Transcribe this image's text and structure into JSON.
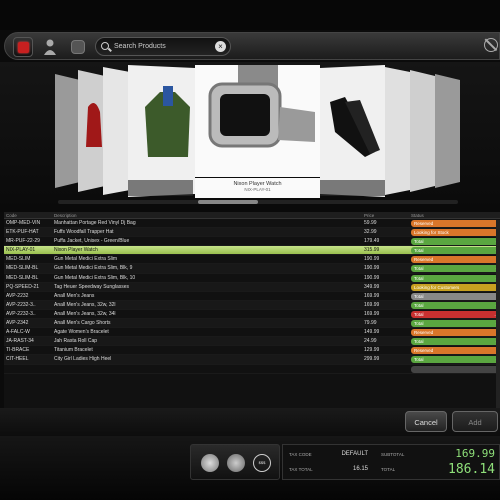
{
  "toolbar": {
    "search_placeholder": "Search Products",
    "clear_label": "×"
  },
  "coverflow": {
    "selected_title": "Nixon Player Watch",
    "selected_code": "NIX-PLAY-01"
  },
  "grid": {
    "columns": [
      "Code",
      "Description",
      "Price",
      "Status"
    ],
    "rows": [
      {
        "code": "OMP-MED-VIN",
        "desc": "Manhattan Portage Red Vinyl Dj Bag",
        "price": "59.99",
        "status": "Reserved",
        "color": "#d9762a",
        "num": ""
      },
      {
        "code": "ETK-PUF-HAT",
        "desc": "Fuffs Woodfall Trapper Hat",
        "price": "32.99",
        "status": "Looking for Stock",
        "color": "#d9762a",
        "num": ""
      },
      {
        "code": "MR-PUF-22-29",
        "desc": "Puffa Jacket, Unisex - Green/Blue",
        "price": "179.49",
        "status": "Total",
        "color": "#5aa640",
        "num": "0"
      },
      {
        "code": "NIX-PLAY-01",
        "desc": "Nixon Player Watch",
        "price": "315.99",
        "status": "Total",
        "color": "#5aa640",
        "num": "0"
      },
      {
        "code": "MED-SLIM",
        "desc": "Gun Metal Medici Extra Slim",
        "price": "190.99",
        "status": "Reserved",
        "color": "#d9762a",
        "num": ""
      },
      {
        "code": "MED-SLIM-BL",
        "desc": "Gun Metal Medici Extra Slim, Blk, 9",
        "price": "190.99",
        "status": "Total",
        "color": "#5aa640",
        "num": "0"
      },
      {
        "code": "MED-SLIM-BL",
        "desc": "Gun Metal Medici Extra Slim, Blk, 10",
        "price": "190.99",
        "status": "Total",
        "color": "#5aa640",
        "num": "0"
      },
      {
        "code": "PQ-SPEED-21",
        "desc": "Tag Heuer Speedway Sunglasses",
        "price": "349.99",
        "status": "Looking for Customers",
        "color": "#c8a020",
        "num": ""
      },
      {
        "code": "AVP-2232",
        "desc": "Anall Men's Jeans",
        "price": "169.99",
        "status": "Total",
        "color": "#888888",
        "num": ""
      },
      {
        "code": "AVP-2232-3..",
        "desc": "Anall Men's Jeans, 32w, 32l",
        "price": "169.99",
        "status": "Total",
        "color": "#5aa640",
        "num": "0"
      },
      {
        "code": "AVP-2232-3..",
        "desc": "Anall Men's Jeans, 32w, 34l",
        "price": "169.99",
        "status": "Total",
        "color": "#c83030",
        "num": "-1"
      },
      {
        "code": "AVP-2342",
        "desc": "Anall Men's Cargo Shorts",
        "price": "79.99",
        "status": "Total",
        "color": "#5aa640",
        "num": "0"
      },
      {
        "code": "A-FALC-W",
        "desc": "Agate Women's Bracelet",
        "price": "149.99",
        "status": "Reserved",
        "color": "#d9762a",
        "num": ""
      },
      {
        "code": "JA-RAST-34",
        "desc": "Jah Rasta Roll Cap",
        "price": "24.99",
        "status": "Total",
        "color": "#5aa640",
        "num": "0"
      },
      {
        "code": "TI-BRACE",
        "desc": "Titanium Bracelet",
        "price": "129.99",
        "status": "Reserved",
        "color": "#d9762a",
        "num": ""
      },
      {
        "code": "CIT-HEEL",
        "desc": "City Girl Ladies High Heel",
        "price": "299.99",
        "status": "Total",
        "color": "#5aa640",
        "num": "0"
      },
      {
        "code": "",
        "desc": "",
        "price": "",
        "status": "",
        "color": "#444444",
        "num": ""
      }
    ]
  },
  "actions": {
    "cancel": "Cancel",
    "add": "Add"
  },
  "footer": {
    "tax_code_label": "TAX CODE",
    "tax_code_value": "DEFAULT",
    "tax_total_label": "TAX TOTAL",
    "tax_total_value": "16.15",
    "subtotal_label": "SUBTOTAL",
    "subtotal_value": "169.99",
    "total_label": "TOTAL",
    "total_value": "186.14",
    "icon_c_text": "$$$"
  }
}
